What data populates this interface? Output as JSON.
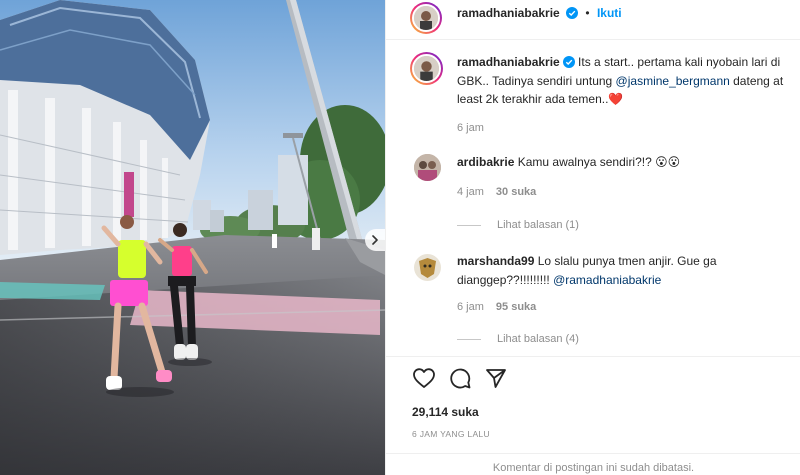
{
  "post": {
    "author": "ramadhaniabakrie",
    "follow_label": "Ikuti",
    "separator": "•"
  },
  "caption": {
    "username": "ramadhaniabakrie",
    "text_part1": " Its a start.. pertama kali nyobain lari di GBK.. Tadinya sendiri untung ",
    "mention": "@jasmine_bergmann",
    "text_part2": " dateng at least 2k terakhir ada temen..",
    "emoji": "❤️",
    "time": "6 jam"
  },
  "comments": [
    {
      "username": "ardibakrie",
      "text": " Kamu awalnya sendiri?!? ",
      "emoji": "😮😮",
      "time": "4 jam",
      "likes": "30 suka",
      "replies_label": "Lihat balasan (1)"
    },
    {
      "username": "marshanda99",
      "text": " Lo slalu punya tmen anjir. Gue ga dianggep??!!!!!!!!! ",
      "mention": "@ramadhaniabakrie",
      "time": "6 jam",
      "likes": "95 suka",
      "replies_label": "Lihat balasan (4)"
    }
  ],
  "footer": {
    "likes_count": "29,114 suka",
    "posted_ago": "6 JAM YANG LALU",
    "comments_closed": "Komentar di postingan ini sudah dibatasi."
  },
  "icons": {
    "like": "heart-icon",
    "comment": "comment-icon",
    "share": "share-icon",
    "verified": "verified-badge-icon",
    "next": "chevron-right-icon"
  },
  "colors": {
    "link": "#0095f6",
    "mention": "#00376b",
    "muted": "#8e8e8e",
    "heart": "#ed1c24"
  }
}
